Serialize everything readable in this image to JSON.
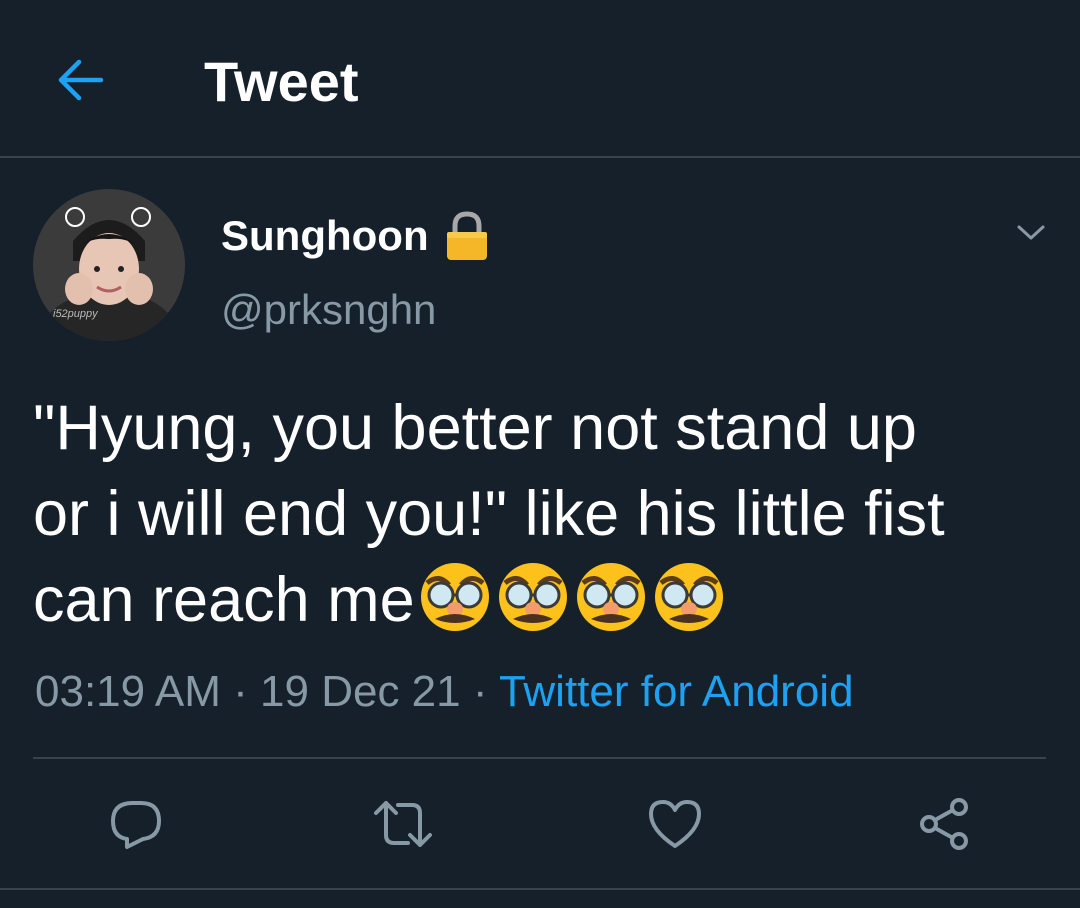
{
  "header": {
    "title": "Tweet",
    "back_icon": "arrow-left-icon"
  },
  "author": {
    "display_name": "Sunghoon",
    "handle": "@prksnghn",
    "protected_icon": "lock-icon",
    "avatar_watermark": "i52puppy"
  },
  "tweet": {
    "text": "\"Hyung, you better not stand up\nor i will end you!\" like his little fist\ncan reach me",
    "emoji": [
      "disguised-face",
      "disguised-face",
      "disguised-face",
      "disguised-face"
    ]
  },
  "meta": {
    "time": "03:19 AM",
    "date": "19 Dec 21",
    "separator": "·",
    "source": "Twitter for Android"
  },
  "actions": [
    "reply-icon",
    "retweet-icon",
    "like-icon",
    "share-icon"
  ],
  "colors": {
    "background": "#15202b",
    "divider": "#38444d",
    "accent": "#1da1f2",
    "secondary_text": "#8899a6"
  }
}
